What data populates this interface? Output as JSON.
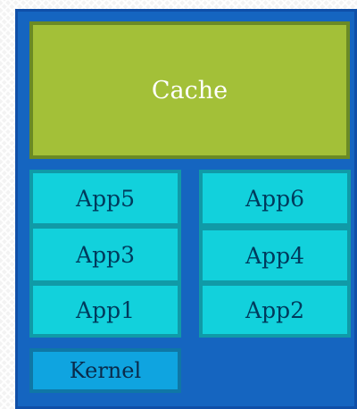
{
  "diagram": {
    "cache_label": "Cache",
    "apps": {
      "app5": "App5",
      "app6": "App6",
      "app3": "App3",
      "app4": "App4",
      "app1": "App1",
      "app2": "App2"
    },
    "kernel_label": "Kernel"
  },
  "colors": {
    "frame": "#1565c0",
    "cache": "#a3c038",
    "app": "#12d1dc",
    "kernel": "#0fa4e0"
  }
}
